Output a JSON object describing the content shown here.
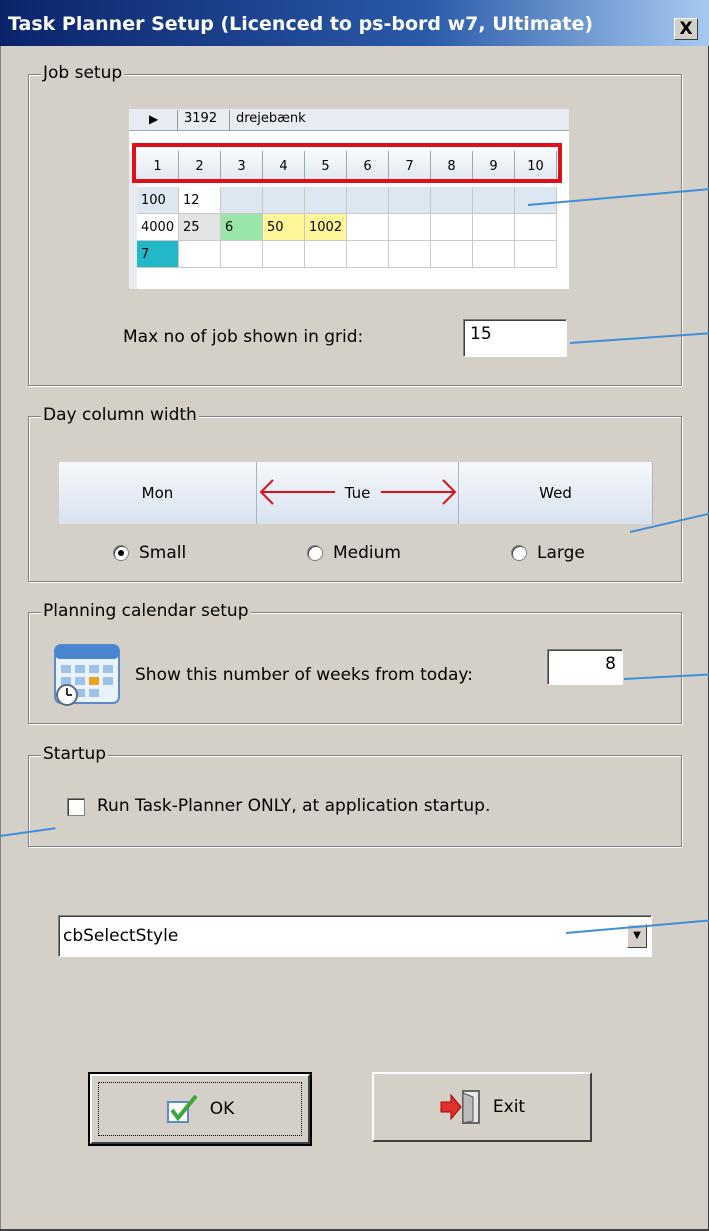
{
  "window": {
    "title": "Task Planner Setup (Licenced to ps-bord w7, Ultimate)",
    "close_label": "X"
  },
  "job_setup": {
    "legend": "Job setup",
    "grid_top": {
      "number": "3192",
      "name": "drejebænk"
    },
    "headers": [
      "1",
      "2",
      "3",
      "4",
      "5",
      "6",
      "7",
      "8",
      "9",
      "10"
    ],
    "rows": [
      [
        "100",
        "12",
        "",
        "",
        "",
        "",
        "",
        "",
        "",
        ""
      ],
      [
        "4000",
        "25",
        "6",
        "50",
        "1002",
        "",
        "",
        "",
        "",
        ""
      ],
      [
        "7",
        "",
        "",
        "",
        "",
        "",
        "",
        "",
        "",
        ""
      ]
    ],
    "max_label": "Max no of job shown in grid:",
    "max_value": "15"
  },
  "day_column": {
    "legend": "Day column width",
    "days": [
      "Mon",
      "Tue",
      "Wed"
    ],
    "options": [
      {
        "label": "Small",
        "checked": true
      },
      {
        "label": "Medium",
        "checked": false
      },
      {
        "label": "Large",
        "checked": false
      }
    ]
  },
  "planning": {
    "legend": "Planning calendar setup",
    "label": "Show this number of weeks from today:",
    "value": "8",
    "icon": "calendar-icon"
  },
  "startup": {
    "legend": "Startup",
    "checkbox_label": "Run Task-Planner ONLY, at application startup.",
    "checked": false
  },
  "style_select": {
    "value": "cbSelectStyle"
  },
  "buttons": {
    "ok": "OK",
    "exit": "Exit"
  },
  "colors": {
    "callout": "#3f8fd8",
    "highlight_box": "#e0101a",
    "cell_green": "#99e6a8",
    "cell_yellow": "#fff69a",
    "cell_teal": "#22b8c8",
    "cell_gray": "#e4e4e4"
  }
}
